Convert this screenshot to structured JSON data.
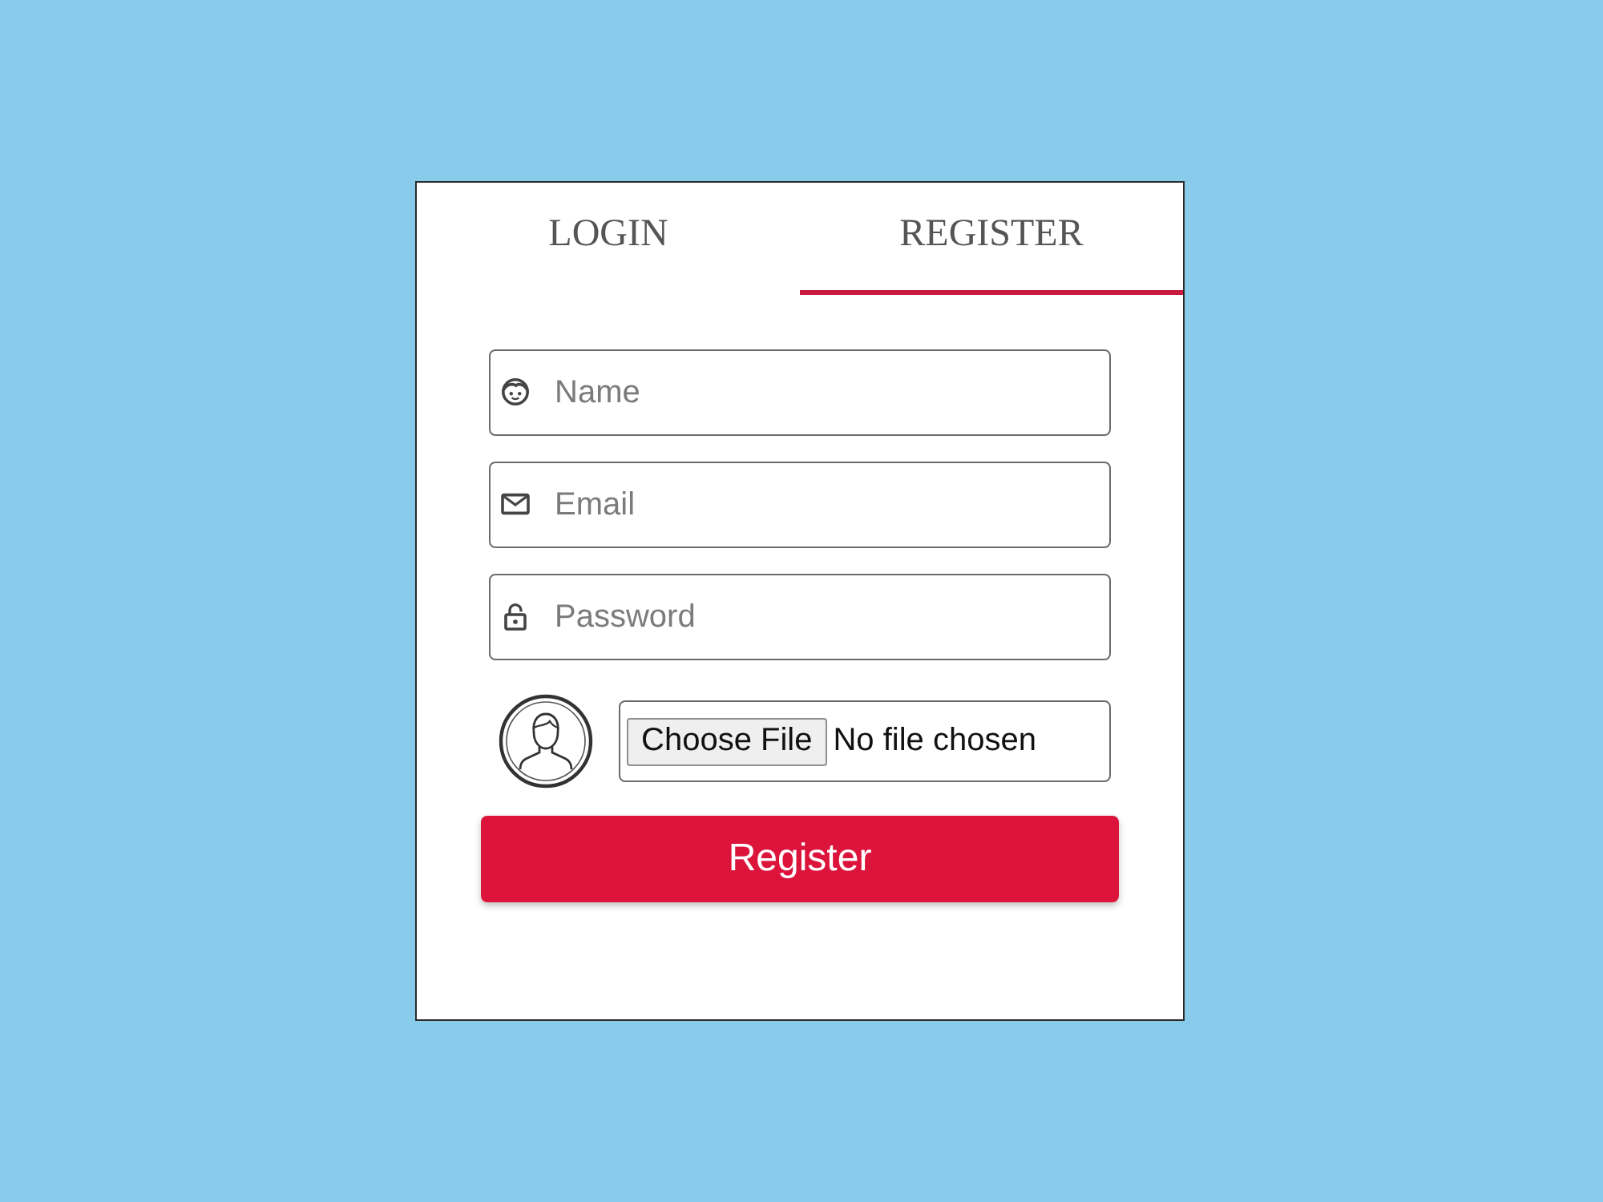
{
  "tabs": [
    {
      "label": "LOGIN",
      "selected": false
    },
    {
      "label": "REGISTER",
      "selected": true
    }
  ],
  "fields": [
    {
      "kind": "name",
      "placeholder": "Name"
    },
    {
      "kind": "email",
      "placeholder": "Email"
    },
    {
      "kind": "password",
      "placeholder": "Password"
    }
  ],
  "avatar_upload": {
    "button": "Choose File",
    "status": "No file chosen"
  },
  "submit": {
    "label": "Register"
  }
}
